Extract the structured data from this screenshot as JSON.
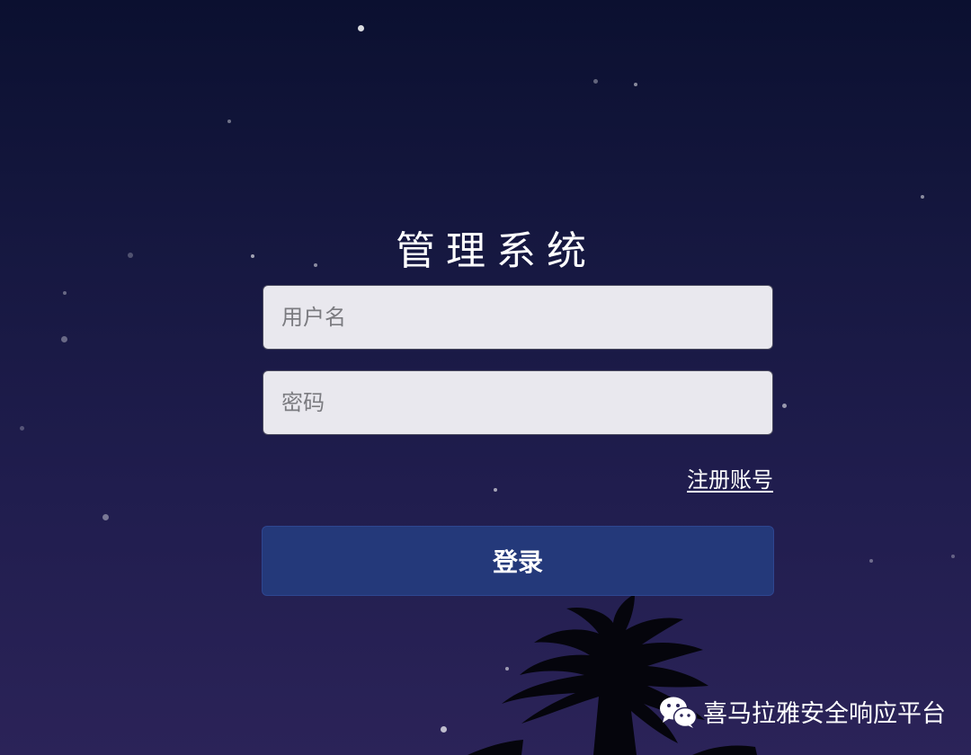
{
  "app": {
    "title": "管理系统"
  },
  "login_form": {
    "username_placeholder": "用户名",
    "password_placeholder": "密码",
    "register_link": "注册账号",
    "login_button": "登录"
  },
  "watermark": {
    "text": "喜马拉雅安全响应平台",
    "icon": "wechat-icon"
  },
  "colors": {
    "background_top": "#0b1030",
    "background_bottom": "#2b2358",
    "input_background": "#e9e8ee",
    "button_background": "#24397a",
    "text": "#ffffff"
  }
}
